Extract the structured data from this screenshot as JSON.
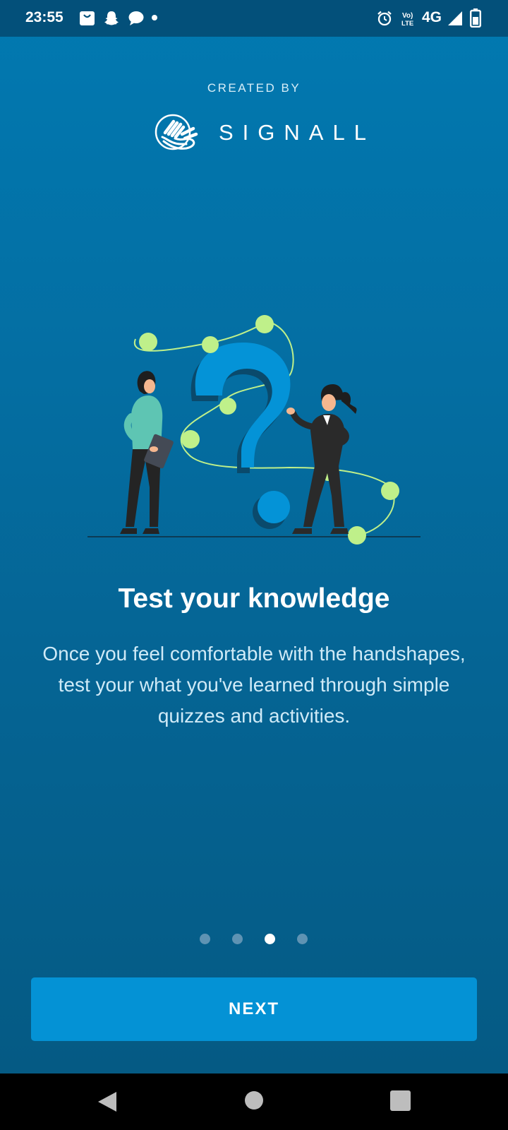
{
  "status_bar": {
    "time": "23:55",
    "network": "4G",
    "left_icons": [
      "shopping-bag-icon",
      "snapchat-ghost-icon",
      "chat-bubble-icon",
      "dot-icon"
    ],
    "right_icons": [
      "alarm-icon",
      "volte-icon",
      "signal-icon",
      "battery-icon"
    ]
  },
  "header": {
    "created_by": "CREATED BY",
    "brand": "SIGNALL"
  },
  "onboarding": {
    "title": "Test your knowledge",
    "description": "Once you feel comfortable with the handshapes, test your what you've learned through simple quizzes and activities.",
    "page_count": 4,
    "current_page": 3
  },
  "actions": {
    "next_label": "NEXT"
  },
  "colors": {
    "accent": "#0492d5",
    "highlight_dots": "#bff08a",
    "background_top": "#0179b1",
    "background_bottom": "#055a84"
  }
}
